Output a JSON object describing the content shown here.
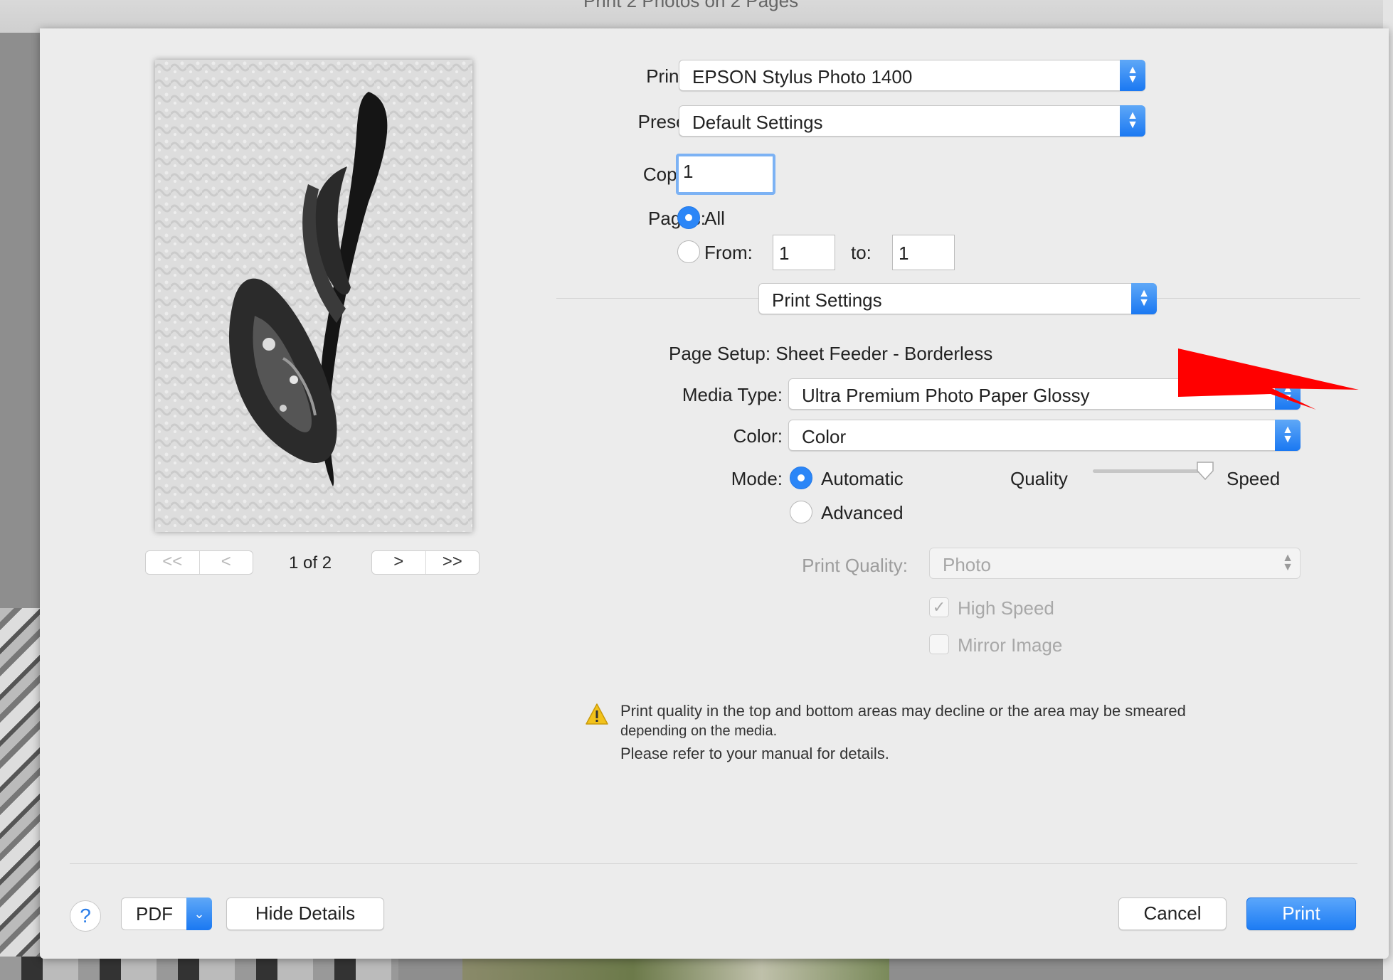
{
  "window": {
    "title": "Print 2 Photos on 2 Pages"
  },
  "preview": {
    "page_indicator": "1 of 2",
    "first": "<<",
    "prev": "<",
    "next": ">",
    "last": ">>"
  },
  "printer": {
    "label": "Printer:",
    "value": "EPSON Stylus Photo 1400"
  },
  "presets": {
    "label": "Presets:",
    "value": "Default Settings"
  },
  "copies": {
    "label": "Copies:",
    "value": "1"
  },
  "pages": {
    "label": "Pages:",
    "all_label": "All",
    "all_selected": true,
    "from_label": "From:",
    "from_value": "1",
    "to_label": "to:",
    "to_value": "1"
  },
  "section_popup": {
    "value": "Print Settings"
  },
  "print_settings": {
    "page_setup": "Page Setup: Sheet Feeder - Borderless",
    "media_type_label": "Media Type:",
    "media_type_value": "Ultra Premium Photo Paper Glossy",
    "color_label": "Color:",
    "color_value": "Color",
    "mode_label": "Mode:",
    "mode_automatic": "Automatic",
    "mode_advanced": "Advanced",
    "mode_selected": "Automatic",
    "quality_label": "Quality",
    "speed_label": "Speed",
    "quality_speed_level": 1.0,
    "print_quality_label": "Print Quality:",
    "print_quality_value": "Photo",
    "high_speed_label": "High Speed",
    "high_speed_checked": true,
    "mirror_image_label": "Mirror Image",
    "mirror_image_checked": false
  },
  "warning": {
    "line1": "Print quality in the top and bottom areas may decline or the area may be smeared",
    "line2": "depending on the media.",
    "line3": "Please refer to your manual for details."
  },
  "footer": {
    "help": "?",
    "pdf": "PDF",
    "hide_details": "Hide Details",
    "cancel": "Cancel",
    "print": "Print"
  },
  "colors": {
    "accent": "#1d7cf4",
    "annotation_arrow": "#ff0000",
    "sheet_bg": "#ececec"
  },
  "icons": {
    "warning": "warning-triangle-icon",
    "popup_arrows": "updown-chevron-icon",
    "pdf_dropdown": "chevron-down-icon"
  }
}
